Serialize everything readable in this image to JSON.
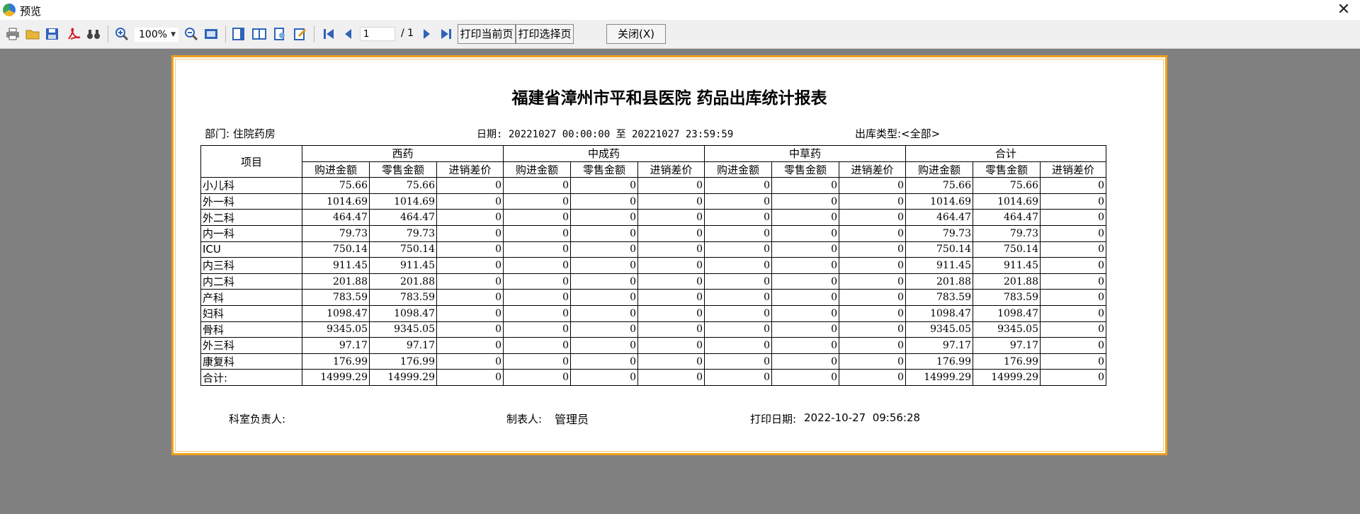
{
  "window": {
    "title": "预览",
    "close_glyph": "✕"
  },
  "toolbar": {
    "zoom": "100%",
    "page_current": "1",
    "page_total": "/ 1",
    "print_current_label": "打印当前页",
    "print_selected_label": "打印选择页",
    "close_label": "关闭(X)"
  },
  "report": {
    "title": "福建省漳州市平和县医院 药品出库统计报表",
    "dept": "部门: 住院药房",
    "date_range": "日期: 20221027 00:00:00 至 20221027 23:59:59",
    "out_type": "出库类型:<全部>",
    "columns": {
      "item": "项目",
      "groups": [
        "西药",
        "中成药",
        "中草药",
        "合计"
      ],
      "sub": [
        "购进金额",
        "零售金额",
        "进销差价"
      ]
    },
    "rows": [
      {
        "name": "小儿科",
        "values": [
          "75.66",
          "75.66",
          "0",
          "0",
          "0",
          "0",
          "0",
          "0",
          "0",
          "75.66",
          "75.66",
          "0"
        ]
      },
      {
        "name": "外一科",
        "values": [
          "1014.69",
          "1014.69",
          "0",
          "0",
          "0",
          "0",
          "0",
          "0",
          "0",
          "1014.69",
          "1014.69",
          "0"
        ]
      },
      {
        "name": "外二科",
        "values": [
          "464.47",
          "464.47",
          "0",
          "0",
          "0",
          "0",
          "0",
          "0",
          "0",
          "464.47",
          "464.47",
          "0"
        ]
      },
      {
        "name": "内一科",
        "values": [
          "79.73",
          "79.73",
          "0",
          "0",
          "0",
          "0",
          "0",
          "0",
          "0",
          "79.73",
          "79.73",
          "0"
        ]
      },
      {
        "name": "ICU",
        "values": [
          "750.14",
          "750.14",
          "0",
          "0",
          "0",
          "0",
          "0",
          "0",
          "0",
          "750.14",
          "750.14",
          "0"
        ]
      },
      {
        "name": "内三科",
        "values": [
          "911.45",
          "911.45",
          "0",
          "0",
          "0",
          "0",
          "0",
          "0",
          "0",
          "911.45",
          "911.45",
          "0"
        ]
      },
      {
        "name": "内二科",
        "values": [
          "201.88",
          "201.88",
          "0",
          "0",
          "0",
          "0",
          "0",
          "0",
          "0",
          "201.88",
          "201.88",
          "0"
        ]
      },
      {
        "name": "产科",
        "values": [
          "783.59",
          "783.59",
          "0",
          "0",
          "0",
          "0",
          "0",
          "0",
          "0",
          "783.59",
          "783.59",
          "0"
        ]
      },
      {
        "name": "妇科",
        "values": [
          "1098.47",
          "1098.47",
          "0",
          "0",
          "0",
          "0",
          "0",
          "0",
          "0",
          "1098.47",
          "1098.47",
          "0"
        ]
      },
      {
        "name": "骨科",
        "values": [
          "9345.05",
          "9345.05",
          "0",
          "0",
          "0",
          "0",
          "0",
          "0",
          "0",
          "9345.05",
          "9345.05",
          "0"
        ]
      },
      {
        "name": "外三科",
        "values": [
          "97.17",
          "97.17",
          "0",
          "0",
          "0",
          "0",
          "0",
          "0",
          "0",
          "97.17",
          "97.17",
          "0"
        ]
      },
      {
        "name": "康复科",
        "values": [
          "176.99",
          "176.99",
          "0",
          "0",
          "0",
          "0",
          "0",
          "0",
          "0",
          "176.99",
          "176.99",
          "0"
        ]
      },
      {
        "name": "合计:",
        "values": [
          "14999.29",
          "14999.29",
          "0",
          "0",
          "0",
          "0",
          "0",
          "0",
          "0",
          "14999.29",
          "14999.29",
          "0"
        ]
      }
    ],
    "footer": {
      "dept_head": "科室负责人:",
      "maker_label": "制表人:",
      "maker": "管理员",
      "print_date_label": "打印日期:",
      "print_date": "2022-10-27  09:56:28"
    }
  },
  "colors": {
    "background": "#808080",
    "paper_border": "#f0a020",
    "toolbar": "#f0f0f0"
  }
}
